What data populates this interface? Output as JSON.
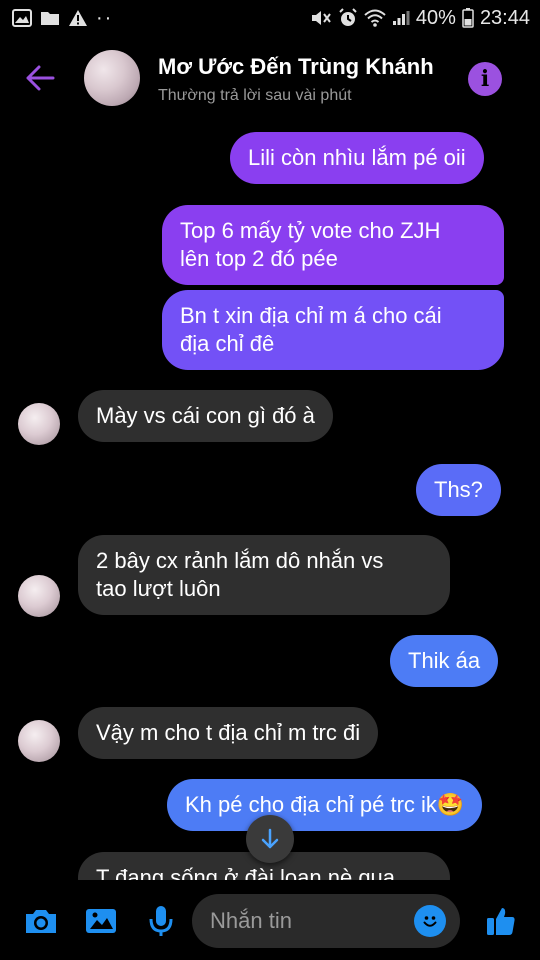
{
  "status_bar": {
    "battery": "40%",
    "time": "23:44",
    "left_dots": "··"
  },
  "header": {
    "name": "Mơ Ước Đến Trùng Khánh",
    "status": "Thường trả lời sau vài phút",
    "info_icon": "i"
  },
  "messages": [
    {
      "sender": "me",
      "text": "Lili còn nhìu lắm pé oii"
    },
    {
      "sender": "me",
      "text_lines": [
        "Top 6 mấy tỷ vote cho ZJH",
        "lên top 2 đó pée"
      ]
    },
    {
      "sender": "me",
      "text_lines": [
        "Bn t xin địa chỉ m á cho cái",
        "địa chỉ đê"
      ]
    },
    {
      "sender": "them",
      "text": "Mày vs cái con gì đó à"
    },
    {
      "sender": "me",
      "text": "Ths?"
    },
    {
      "sender": "them",
      "text_lines": [
        "2 bây cx rảnh lắm dô nhắn vs",
        "tao lượt luôn"
      ]
    },
    {
      "sender": "me",
      "text": "Thik áa"
    },
    {
      "sender": "them",
      "text": "Vậy m cho t địa chỉ m trc đi"
    },
    {
      "sender": "me",
      "text": "Kh pé cho địa chỉ pé trc ik🤩"
    },
    {
      "sender": "them",
      "text": "T đang sống ở đài loan nè qua"
    }
  ],
  "composer": {
    "placeholder": "Nhắn tin"
  },
  "colors": {
    "accent_purple": "#9b51e0",
    "accent_blue": "#1e8ff0",
    "incoming_bubble": "#2f2f2f"
  }
}
